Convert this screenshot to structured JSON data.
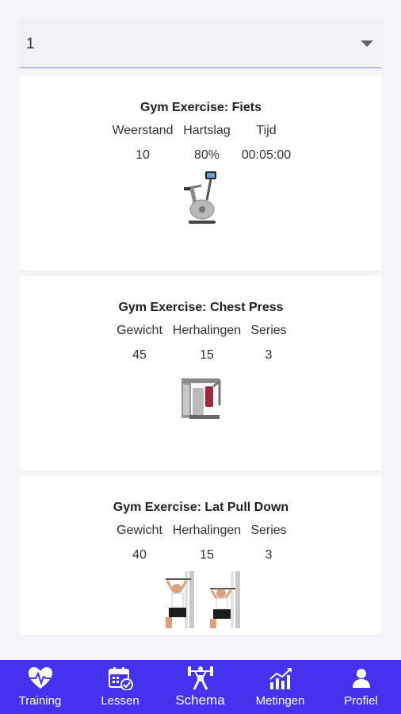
{
  "dropdown": {
    "selected": "1"
  },
  "cards": [
    {
      "title": "Gym Exercise: Fiets",
      "columns": [
        {
          "label": "Weerstand",
          "value": "10"
        },
        {
          "label": "Hartslag",
          "value": "80%"
        },
        {
          "label": "Tijd",
          "value": "00:05:00"
        }
      ],
      "image": "exercise-bike-icon"
    },
    {
      "title": "Gym Exercise: Chest Press",
      "columns": [
        {
          "label": "Gewicht",
          "value": "45"
        },
        {
          "label": "Herhalingen",
          "value": "15"
        },
        {
          "label": "Series",
          "value": "3"
        }
      ],
      "image": "chest-press-machine-icon"
    },
    {
      "title": "Gym Exercise: Lat Pull Down",
      "columns": [
        {
          "label": "Gewicht",
          "value": "40"
        },
        {
          "label": "Herhalingen",
          "value": "15"
        },
        {
          "label": "Series",
          "value": "3"
        }
      ],
      "image": "lat-pull-down-icon"
    }
  ],
  "nav": {
    "accent_color": "#4433ee",
    "items": [
      {
        "label": "Training",
        "icon": "heart-pulse-icon"
      },
      {
        "label": "Lessen",
        "icon": "calendar-check-icon"
      },
      {
        "label": "Schema",
        "icon": "weightlifter-icon",
        "active": true
      },
      {
        "label": "Metingen",
        "icon": "chart-growth-icon"
      },
      {
        "label": "Profiel",
        "icon": "person-icon"
      }
    ]
  }
}
